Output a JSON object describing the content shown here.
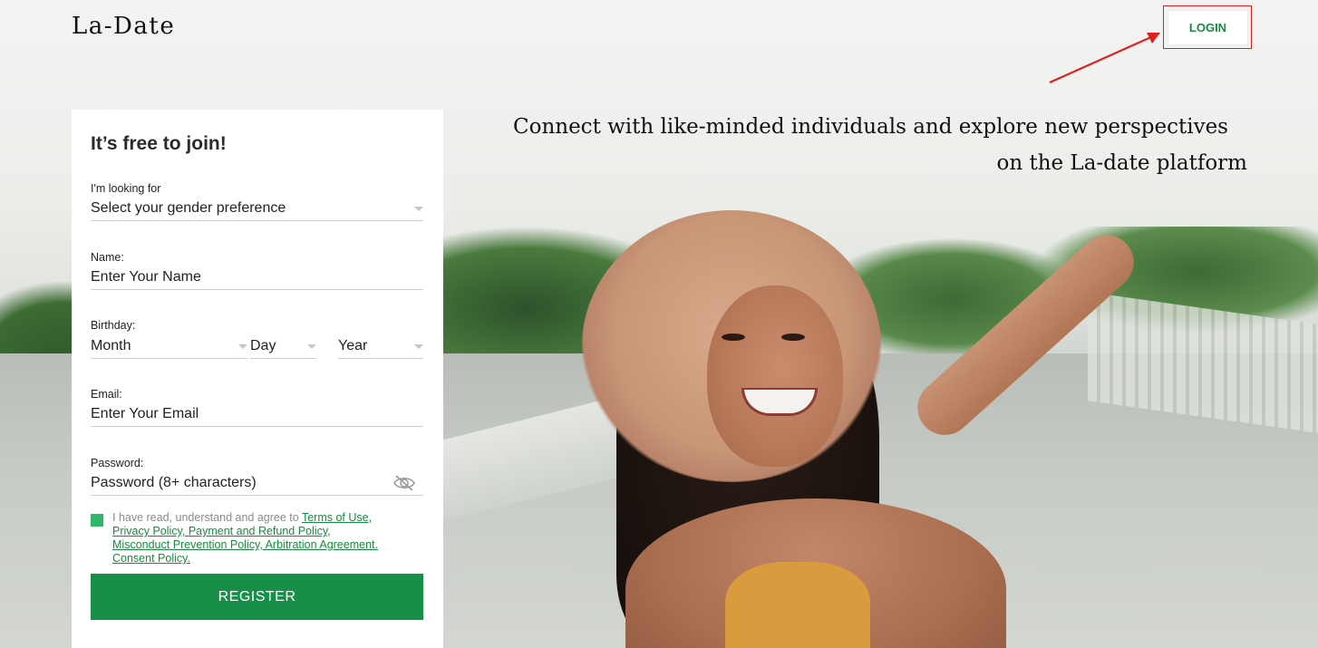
{
  "brand": {
    "logo": "La-Date"
  },
  "header": {
    "login_label": "LOGIN"
  },
  "hero": {
    "tagline_line1": "Connect with like-minded individuals and explore new perspectives",
    "tagline_line2": "on the La-date platform"
  },
  "form": {
    "title": "It’s free to join!",
    "gender": {
      "label": "I'm looking for",
      "value": "Select your gender preference"
    },
    "name": {
      "label": "Name:",
      "placeholder": "Enter Your Name"
    },
    "birthday": {
      "label": "Birthday:",
      "month": "Month",
      "day": "Day",
      "year": "Year"
    },
    "email": {
      "label": "Email:",
      "placeholder": "Enter Your Email"
    },
    "password": {
      "label": "Password:",
      "placeholder": "Password (8+ characters)"
    },
    "terms": {
      "prefix": "I have read, understand and agree to ",
      "link1": "Terms of Use,",
      "link2": "Privacy Policy, Payment and Refund Policy,",
      "link3": "Misconduct Prevention Policy, Arbitration Agreement.",
      "link4": "Consent Policy."
    },
    "register_label": "REGISTER"
  },
  "colors": {
    "accent_green": "#178f49",
    "checkbox_green": "#2fb86b",
    "link_green": "#178a3e",
    "highlight_red": "#e02020"
  },
  "icons": {
    "password_toggle": "eye-slash-icon",
    "dropdown": "chevron-down-icon"
  }
}
